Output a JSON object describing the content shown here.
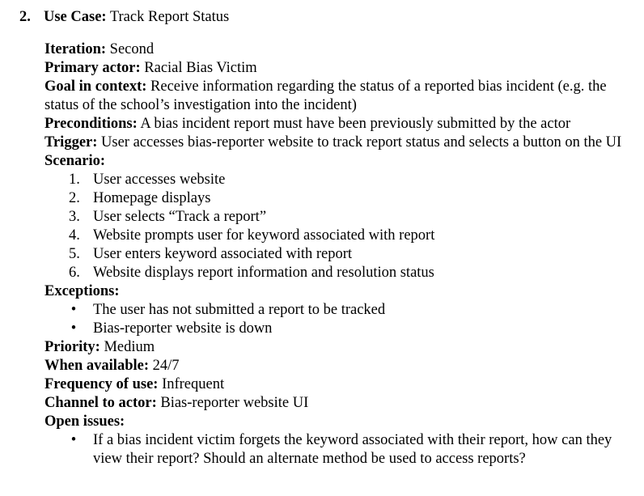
{
  "heading": {
    "number": "2.",
    "label": "Use Case:",
    "value": "Track Report Status"
  },
  "fields": [
    {
      "label": "Iteration:",
      "value": "Second"
    },
    {
      "label": "Primary actor:",
      "value": "Racial Bias Victim"
    },
    {
      "label": "Goal in context:",
      "value": "Receive information regarding the status of a reported bias incident (e.g. the status of the school’s investigation into the incident)"
    },
    {
      "label": "Preconditions:",
      "value": "A bias incident report must have been previously submitted by the actor"
    },
    {
      "label": "Trigger:",
      "value": "User accesses bias-reporter website to track report status and selects a button on the UI"
    }
  ],
  "scenario": {
    "label": "Scenario:",
    "steps": [
      "User accesses website",
      "Homepage displays",
      "User selects “Track a report”",
      "Website prompts user for keyword associated with report",
      "User enters keyword associated with report",
      "Website displays report information and resolution status"
    ],
    "step_numbers": [
      "1.",
      "2.",
      "3.",
      "4.",
      "5.",
      "6."
    ]
  },
  "exceptions": {
    "label": "Exceptions:",
    "items": [
      "The user has not submitted a report to be tracked",
      "Bias-reporter website is down"
    ]
  },
  "fields2": [
    {
      "label": "Priority:",
      "value": "Medium"
    },
    {
      "label": "When available:",
      "value": "24/7"
    },
    {
      "label": "Frequency of use:",
      "value": "Infrequent"
    },
    {
      "label": "Channel to actor:",
      "value": "Bias-reporter website UI"
    }
  ],
  "open_issues": {
    "label": "Open issues:",
    "items": [
      "If a bias incident victim forgets the keyword associated with their report, how can they view their report? Should an alternate method be used to access reports?"
    ]
  }
}
